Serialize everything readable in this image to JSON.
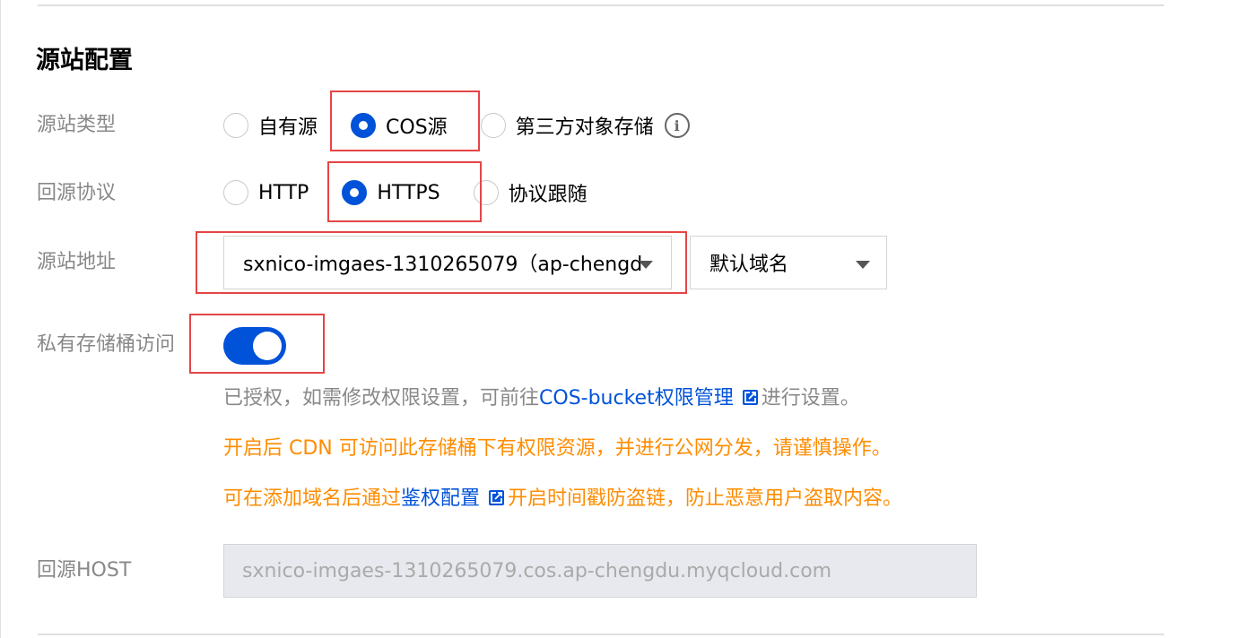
{
  "section": {
    "title": "源站配置"
  },
  "origin_type": {
    "label": "源站类型",
    "options": [
      "自有源",
      "COS源",
      "第三方对象存储"
    ],
    "selected": "COS源"
  },
  "protocol": {
    "label": "回源协议",
    "options": [
      "HTTP",
      "HTTPS",
      "协议跟随"
    ],
    "selected": "HTTPS"
  },
  "origin_address": {
    "label": "源站地址",
    "bucket_value": "sxnico-imgaes-1310265079（ap-chengd",
    "domain_value": "默认域名"
  },
  "private_access": {
    "label": "私有存储桶访问",
    "enabled": true
  },
  "notes": {
    "authorized_prefix": "已授权，如需修改权限设置，可前往",
    "authorized_link": "COS-bucket权限管理",
    "authorized_suffix": "进行设置。",
    "warning": "开启后 CDN 可访问此存储桶下有权限资源，并进行公网分发，请谨慎操作。",
    "hint_prefix": "可在添加域名后通过",
    "hint_link": "鉴权配置",
    "hint_suffix": "开启时间戳防盗链，防止恶意用户盗取内容。"
  },
  "host": {
    "label": "回源HOST",
    "value": "sxnico-imgaes-1310265079.cos.ap-chengdu.myqcloud.com"
  },
  "colors": {
    "accent": "#0052d9",
    "warning": "#ff8c00",
    "highlight_box": "#e54545"
  }
}
